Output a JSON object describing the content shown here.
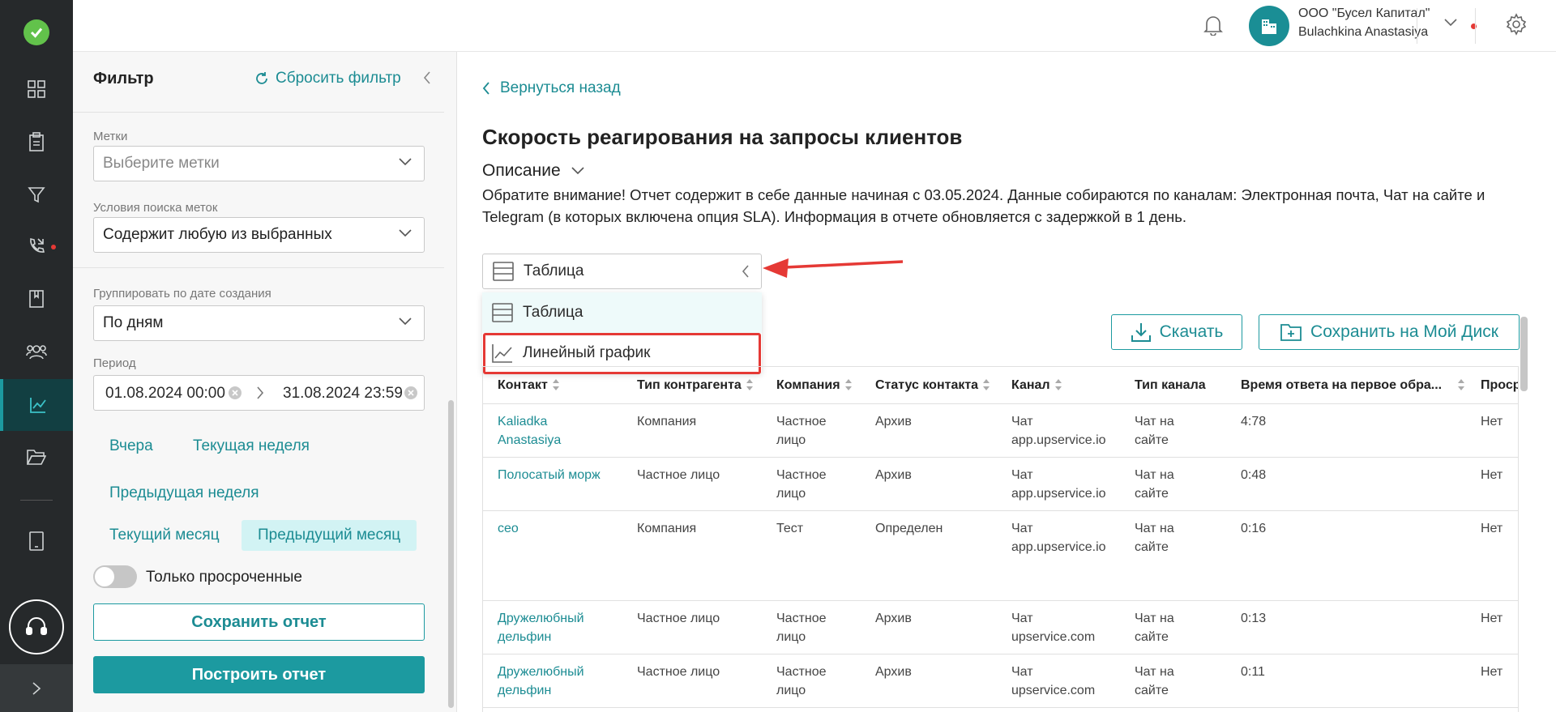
{
  "topbar": {
    "org_name": "ООО \"Бусел Капитал\"",
    "user_name": "Bulachkina Anastasiya"
  },
  "filter": {
    "title": "Фильтр",
    "reset_label": "Сбросить фильтр",
    "tags_label": "Метки",
    "tags_placeholder": "Выберите метки",
    "tag_condition_label": "Условия поиска меток",
    "tag_condition_value": "Содержит любую из выбранных",
    "group_label": "Группировать по дате создания",
    "group_value": "По дням",
    "period_label": "Период",
    "date_from": "01.08.2024 00:00",
    "date_to": "31.08.2024 23:59",
    "chips": {
      "yesterday": "Вчера",
      "current_week": "Текущая неделя",
      "previous_week": "Предыдущая неделя",
      "current_month": "Текущий месяц",
      "previous_month": "Предыдущий месяц"
    },
    "overdue_only_label": "Только просроченные",
    "save_report_label": "Сохранить отчет",
    "build_report_label": "Построить отчет"
  },
  "main": {
    "back_label": "Вернуться назад",
    "title": "Скорость реагирования на запросы клиентов",
    "description_header": "Описание",
    "description_text": "Обратите внимание! Отчет содержит в себе данные начиная с 03.05.2024. Данные собираются по каналам: Электронная почта, Чат на сайте и Telegram (в которых включена опция SLA). Информация в отчете обновляется с задержкой в 1 день.",
    "view_select_value": "Таблица",
    "view_options": [
      "Таблица",
      "Линейный график"
    ],
    "download_label": "Скачать",
    "save_disk_label": "Сохранить на Мой Диск"
  },
  "table": {
    "columns": [
      "Контакт",
      "Тип контрагента",
      "Компания",
      "Статус контакта",
      "Канал",
      "Тип канала",
      "Время ответа на первое обра...",
      "Проср"
    ],
    "rows": [
      {
        "contact": "Kaliadka Anastasiya",
        "type": "Компания",
        "company": "Частное лицо",
        "status": "Архив",
        "channel": "Чат app.upservice.io",
        "channel_type": "Чат на сайте",
        "time": "4:78",
        "overdue": "Нет"
      },
      {
        "contact": "Полосатый морж",
        "type": "Частное лицо",
        "company": "Частное лицо",
        "status": "Архив",
        "channel": "Чат app.upservice.io",
        "channel_type": "Чат на сайте",
        "time": "0:48",
        "overdue": "Нет"
      },
      {
        "contact": "ceo",
        "type": "Компания",
        "company": "Тест",
        "status": "Определен",
        "channel": "Чат app.upservice.io",
        "channel_type": "Чат на сайте",
        "time": "0:16",
        "overdue": "Нет"
      },
      {
        "contact": "Дружелюбный дельфин",
        "type": "Частное лицо",
        "company": "Частное лицо",
        "status": "Архив",
        "channel": "Чат upservice.com",
        "channel_type": "Чат на сайте",
        "time": "0:13",
        "overdue": "Нет"
      },
      {
        "contact": "Дружелюбный дельфин",
        "type": "Частное лицо",
        "company": "Частное лицо",
        "status": "Архив",
        "channel": "Чат upservice.com",
        "channel_type": "Чат на сайте",
        "time": "0:11",
        "overdue": "Нет"
      }
    ]
  },
  "colors": {
    "accent": "#1c9aa0",
    "rail_bg": "#26292b",
    "highlight": "#e53935"
  },
  "icons": [
    "check-icon",
    "dashboard-icon",
    "clipboard-icon",
    "funnel-icon",
    "phone-icon",
    "book-icon",
    "users-icon",
    "chart-icon",
    "folder-icon",
    "tablet-icon",
    "headset-icon",
    "bell-icon",
    "building-icon",
    "gear-icon",
    "logout-icon",
    "refresh-icon",
    "table-icon",
    "line-chart-icon",
    "download-icon",
    "folder-plus-icon"
  ]
}
